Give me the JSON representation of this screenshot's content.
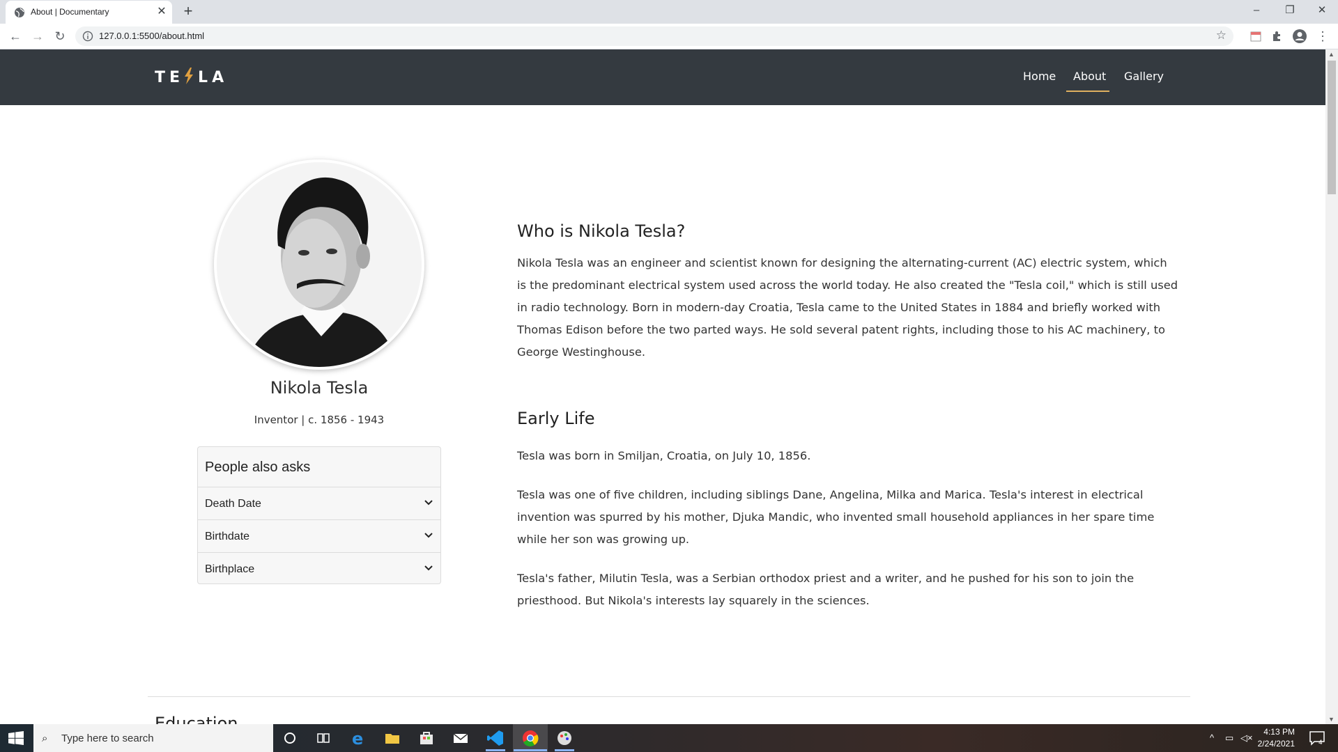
{
  "browser": {
    "tab_title": "About | Documentary",
    "url": "127.0.0.1:5500/about.html",
    "new_tab_icon": "plus-icon",
    "close_tab_icon": "close-icon"
  },
  "site": {
    "logo": "TEϟLA",
    "logo_accent": "#e0a040",
    "nav": [
      {
        "label": "Home",
        "active": false
      },
      {
        "label": "About",
        "active": true
      },
      {
        "label": "Gallery",
        "active": false
      }
    ],
    "nav_bg": "#343a40"
  },
  "profile": {
    "name": "Nikola Tesla",
    "subtitle": "Inventor | c. 1856 - 1943"
  },
  "accordion": {
    "header": "People also asks",
    "items": [
      "Death Date",
      "Birthdate",
      "Birthplace"
    ]
  },
  "sections": [
    {
      "heading": "Who is Nikola Tesla?",
      "paragraphs": [
        "Nikola Tesla was an engineer and scientist known for designing the alternating-current (AC) electric system, which is the predominant electrical system used across the world today. He also created the \"Tesla coil,\" which is still used in radio technology. Born in modern-day Croatia, Tesla came to the United States in 1884 and briefly worked with Thomas Edison before the two parted ways. He sold several patent rights, including those to his AC machinery, to George Westinghouse."
      ]
    },
    {
      "heading": "Early Life",
      "paragraphs": [
        "Tesla was born in Smiljan, Croatia, on July 10, 1856.",
        "Tesla was one of five children, including siblings Dane, Angelina, Milka and Marica. Tesla's interest in electrical invention was spurred by his mother, Djuka Mandic, who invented small household appliances in her spare time while her son was growing up.",
        "Tesla's father, Milutin Tesla, was a Serbian orthodox priest and a writer, and he pushed for his son to join the priesthood. But Nikola's interests lay squarely in the sciences."
      ]
    }
  ],
  "next_section_heading": "Education",
  "taskbar": {
    "search_placeholder": "Type here to search",
    "time": "4:13 PM",
    "date": "2/24/2021",
    "notification_count": "4"
  }
}
